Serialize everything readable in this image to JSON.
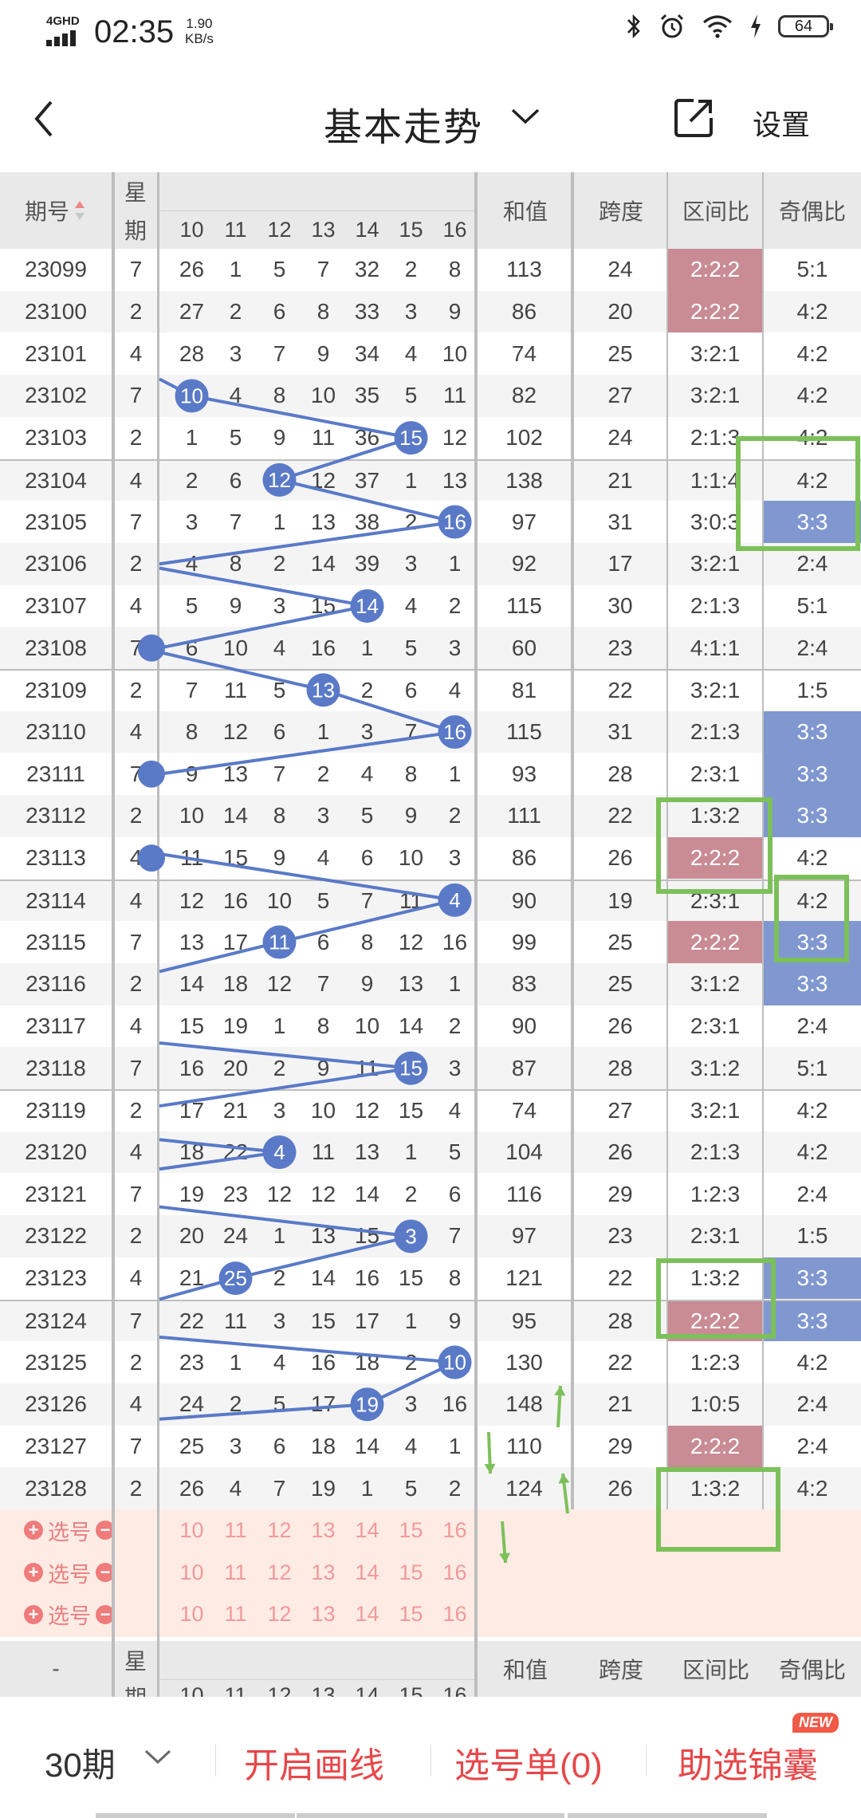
{
  "status": {
    "network": "4GHD",
    "time": "02:35",
    "speed_value": "1.90",
    "speed_unit": "KB/s",
    "battery": "64"
  },
  "nav": {
    "title": "基本走势",
    "settings": "设置"
  },
  "header": {
    "col_issue": "期号",
    "col_week_top": "星",
    "col_week_bottom": "期",
    "nums": [
      "10",
      "11",
      "12",
      "13",
      "14",
      "15",
      "16"
    ],
    "col_sum": "和值",
    "col_span": "跨度",
    "col_zone": "区间比",
    "col_odd": "奇偶比"
  },
  "rows": [
    {
      "issue": "23099",
      "week": "7",
      "n": [
        "26",
        "1",
        "5",
        "7",
        "32",
        "2",
        "8"
      ],
      "sum": "113",
      "span": "24",
      "zone": "2:2:2",
      "odd": "5:1"
    },
    {
      "issue": "23100",
      "week": "2",
      "n": [
        "27",
        "2",
        "6",
        "8",
        "33",
        "3",
        "9"
      ],
      "sum": "86",
      "span": "20",
      "zone": "2:2:2",
      "odd": "4:2"
    },
    {
      "issue": "23101",
      "week": "4",
      "n": [
        "28",
        "3",
        "7",
        "9",
        "34",
        "4",
        "10"
      ],
      "sum": "74",
      "span": "25",
      "zone": "3:2:1",
      "odd": "4:2"
    },
    {
      "issue": "23102",
      "week": "7",
      "n": [
        "10",
        "4",
        "8",
        "10",
        "35",
        "5",
        "11"
      ],
      "sum": "82",
      "span": "27",
      "zone": "3:2:1",
      "odd": "4:2"
    },
    {
      "issue": "23103",
      "week": "2",
      "n": [
        "1",
        "5",
        "9",
        "11",
        "36",
        "15",
        "12"
      ],
      "sum": "102",
      "span": "24",
      "zone": "2:1:3",
      "odd": "4:2"
    },
    {
      "issue": "23104",
      "week": "4",
      "n": [
        "2",
        "6",
        "12",
        "12",
        "37",
        "1",
        "13"
      ],
      "sum": "138",
      "span": "21",
      "zone": "1:1:4",
      "odd": "4:2"
    },
    {
      "issue": "23105",
      "week": "7",
      "n": [
        "3",
        "7",
        "1",
        "13",
        "38",
        "2",
        "16"
      ],
      "sum": "97",
      "span": "31",
      "zone": "3:0:3",
      "odd": "3:3"
    },
    {
      "issue": "23106",
      "week": "2",
      "n": [
        "4",
        "8",
        "2",
        "14",
        "39",
        "3",
        "1"
      ],
      "sum": "92",
      "span": "17",
      "zone": "3:2:1",
      "odd": "2:4"
    },
    {
      "issue": "23107",
      "week": "4",
      "n": [
        "5",
        "9",
        "3",
        "15",
        "14",
        "4",
        "2"
      ],
      "sum": "115",
      "span": "30",
      "zone": "2:1:3",
      "odd": "5:1"
    },
    {
      "issue": "23108",
      "week": "7",
      "n": [
        "6",
        "10",
        "4",
        "16",
        "1",
        "5",
        "3"
      ],
      "sum": "60",
      "span": "23",
      "zone": "4:1:1",
      "odd": "2:4"
    },
    {
      "issue": "23109",
      "week": "2",
      "n": [
        "7",
        "11",
        "5",
        "13",
        "2",
        "6",
        "4"
      ],
      "sum": "81",
      "span": "22",
      "zone": "3:2:1",
      "odd": "1:5"
    },
    {
      "issue": "23110",
      "week": "4",
      "n": [
        "8",
        "12",
        "6",
        "1",
        "3",
        "7",
        "16"
      ],
      "sum": "115",
      "span": "31",
      "zone": "2:1:3",
      "odd": "3:3"
    },
    {
      "issue": "23111",
      "week": "7",
      "n": [
        "9",
        "13",
        "7",
        "2",
        "4",
        "8",
        "1"
      ],
      "sum": "93",
      "span": "28",
      "zone": "2:3:1",
      "odd": "3:3"
    },
    {
      "issue": "23112",
      "week": "2",
      "n": [
        "10",
        "14",
        "8",
        "3",
        "5",
        "9",
        "2"
      ],
      "sum": "111",
      "span": "22",
      "zone": "1:3:2",
      "odd": "3:3"
    },
    {
      "issue": "23113",
      "week": "4",
      "n": [
        "11",
        "15",
        "9",
        "4",
        "6",
        "10",
        "3"
      ],
      "sum": "86",
      "span": "26",
      "zone": "2:2:2",
      "odd": "4:2"
    },
    {
      "issue": "23114",
      "week": "4",
      "n": [
        "12",
        "16",
        "10",
        "5",
        "7",
        "11",
        "4"
      ],
      "sum": "90",
      "span": "19",
      "zone": "2:3:1",
      "odd": "4:2"
    },
    {
      "issue": "23115",
      "week": "7",
      "n": [
        "13",
        "17",
        "11",
        "6",
        "8",
        "12",
        "16"
      ],
      "sum": "99",
      "span": "25",
      "zone": "2:2:2",
      "odd": "3:3"
    },
    {
      "issue": "23116",
      "week": "2",
      "n": [
        "14",
        "18",
        "12",
        "7",
        "9",
        "13",
        "1"
      ],
      "sum": "83",
      "span": "25",
      "zone": "3:1:2",
      "odd": "3:3"
    },
    {
      "issue": "23117",
      "week": "4",
      "n": [
        "15",
        "19",
        "1",
        "8",
        "10",
        "14",
        "2"
      ],
      "sum": "90",
      "span": "26",
      "zone": "2:3:1",
      "odd": "2:4"
    },
    {
      "issue": "23118",
      "week": "7",
      "n": [
        "16",
        "20",
        "2",
        "9",
        "11",
        "15",
        "3"
      ],
      "sum": "87",
      "span": "28",
      "zone": "3:1:2",
      "odd": "5:1"
    },
    {
      "issue": "23119",
      "week": "2",
      "n": [
        "17",
        "21",
        "3",
        "10",
        "12",
        "15",
        "4"
      ],
      "sum": "74",
      "span": "27",
      "zone": "3:2:1",
      "odd": "4:2"
    },
    {
      "issue": "23120",
      "week": "4",
      "n": [
        "18",
        "22",
        "4",
        "11",
        "13",
        "1",
        "5"
      ],
      "sum": "104",
      "span": "26",
      "zone": "2:1:3",
      "odd": "4:2"
    },
    {
      "issue": "23121",
      "week": "7",
      "n": [
        "19",
        "23",
        "12",
        "12",
        "14",
        "2",
        "6"
      ],
      "sum": "116",
      "span": "29",
      "zone": "1:2:3",
      "odd": "2:4"
    },
    {
      "issue": "23122",
      "week": "2",
      "n": [
        "20",
        "24",
        "1",
        "13",
        "15",
        "3",
        "7"
      ],
      "sum": "97",
      "span": "23",
      "zone": "2:3:1",
      "odd": "1:5"
    },
    {
      "issue": "23123",
      "week": "4",
      "n": [
        "21",
        "25",
        "2",
        "14",
        "16",
        "15",
        "8"
      ],
      "sum": "121",
      "span": "22",
      "zone": "1:3:2",
      "odd": "3:3"
    },
    {
      "issue": "23124",
      "week": "7",
      "n": [
        "22",
        "11",
        "3",
        "15",
        "17",
        "1",
        "9"
      ],
      "sum": "95",
      "span": "28",
      "zone": "2:2:2",
      "odd": "3:3"
    },
    {
      "issue": "23125",
      "week": "2",
      "n": [
        "23",
        "1",
        "4",
        "16",
        "18",
        "2",
        "10"
      ],
      "sum": "130",
      "span": "22",
      "zone": "1:2:3",
      "odd": "4:2"
    },
    {
      "issue": "23126",
      "week": "4",
      "n": [
        "24",
        "2",
        "5",
        "17",
        "19",
        "3",
        "16"
      ],
      "sum": "148",
      "span": "21",
      "zone": "1:0:5",
      "odd": "2:4"
    },
    {
      "issue": "23127",
      "week": "7",
      "n": [
        "25",
        "3",
        "6",
        "18",
        "14",
        "4",
        "1"
      ],
      "sum": "110",
      "span": "29",
      "zone": "2:2:2",
      "odd": "2:4"
    },
    {
      "issue": "23128",
      "week": "2",
      "n": [
        "26",
        "4",
        "7",
        "19",
        "1",
        "5",
        "2"
      ],
      "sum": "124",
      "span": "26",
      "zone": "1:3:2",
      "odd": "4:2"
    }
  ],
  "pick": {
    "label": "选号"
  },
  "footer_header": {
    "col_issue": "-",
    "col_week_top": "星",
    "col_week_bottom": "期"
  },
  "bottom": {
    "period": "30期",
    "draw_line": "开启画线",
    "pick_list": "选号单(0)",
    "helper": "助选锦囊",
    "badge": "NEW"
  },
  "colors": {
    "ball": "#5a7ac8",
    "pink_cell": "#c98b94",
    "blue_cell": "#8097d0",
    "green_box": "#7cc05a",
    "accent_red": "#e8474a"
  }
}
